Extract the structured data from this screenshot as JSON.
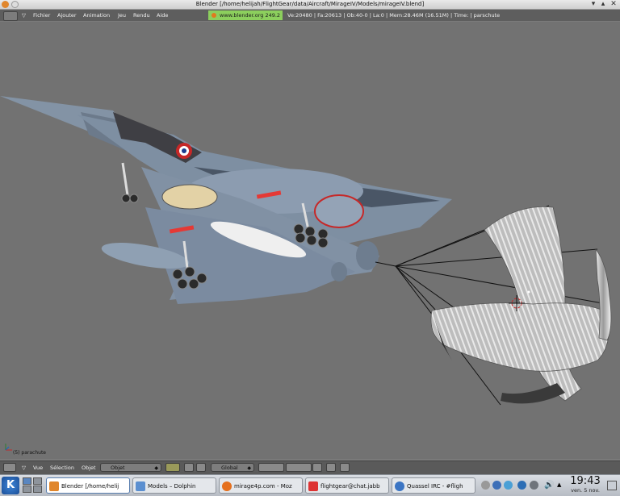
{
  "window": {
    "title": "Blender [/home/helijah/FlightGear/data/Aircraft/MirageIV/Models/mirageIV.blend]"
  },
  "menu": {
    "items": [
      "Fichier",
      "Ajouter",
      "Animation",
      "Jeu",
      "Rendu",
      "Aide"
    ],
    "url": "www.blender.org 249.2",
    "stats": "Ve:20480 | Fa:20613 | Ob:40-0 | La:0 | Mem:28.46M (16.51M) | Time: | parschute"
  },
  "viewport": {
    "object_label": "(5) parachute"
  },
  "header3d": {
    "menus": [
      "Vue",
      "Sélection",
      "Objet"
    ],
    "mode": "Objet",
    "orientation": "Global"
  },
  "taskbar": {
    "tasks": [
      {
        "label": "Blender [/home/helij",
        "icon": "blender-icon",
        "active": true
      },
      {
        "label": "Models – Dolphin",
        "icon": "dolphin-icon",
        "active": false
      },
      {
        "label": "mirage4p.com - Moz",
        "icon": "firefox-icon",
        "active": false
      },
      {
        "label": "flightgear@chat.jabb",
        "icon": "kopete-icon",
        "active": false
      },
      {
        "label": "Quassel IRC - #fligh",
        "icon": "quassel-icon",
        "active": false
      }
    ],
    "clock_time": "19:43",
    "clock_date": "ven. 5 nov."
  }
}
